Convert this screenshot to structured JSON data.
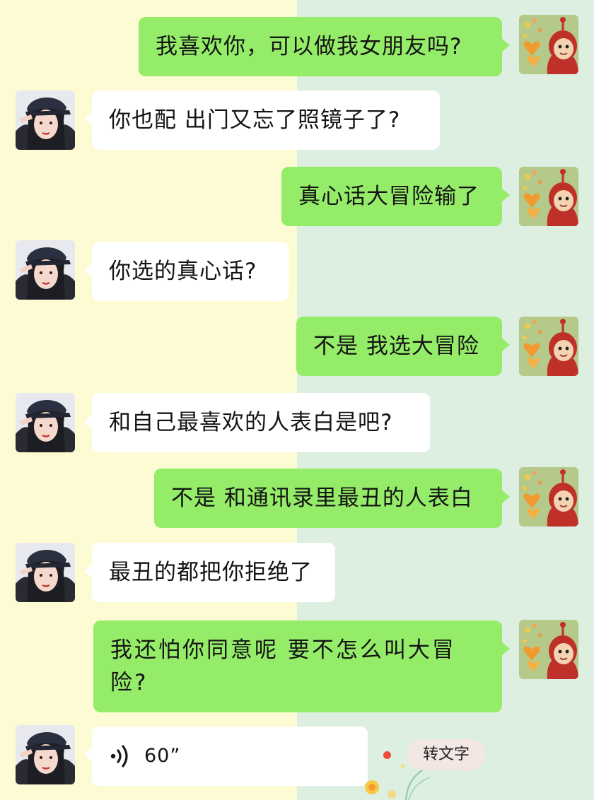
{
  "messages": [
    {
      "from": "me",
      "text": "我喜欢你，可以做我女朋友吗?"
    },
    {
      "from": "them",
      "text": "你也配 出门又忘了照镜子了?"
    },
    {
      "from": "me",
      "text": "真心话大冒险输了"
    },
    {
      "from": "them",
      "text": "你选的真心话?"
    },
    {
      "from": "me",
      "text": "不是 我选大冒险"
    },
    {
      "from": "them",
      "text": "和自己最喜欢的人表白是吧?"
    },
    {
      "from": "me",
      "text": "不是 和通讯录里最丑的人表白"
    },
    {
      "from": "them",
      "text": "最丑的都把你拒绝了"
    },
    {
      "from": "me",
      "text": "我还怕你同意呢 要不怎么叫大冒险?"
    }
  ],
  "voice_message": {
    "duration": "60”",
    "transcribe_label": "转文字",
    "icon": "voice-wave-icon"
  },
  "colors": {
    "my_bubble": "#95ec69",
    "their_bubble": "#ffffff",
    "bg_left": "#fdfbd3",
    "bg_right": "#dcefe0",
    "unread_dot": "#f04a3e"
  },
  "avatars": {
    "me": "teletubby-avatar",
    "them": "girl-avatar"
  }
}
